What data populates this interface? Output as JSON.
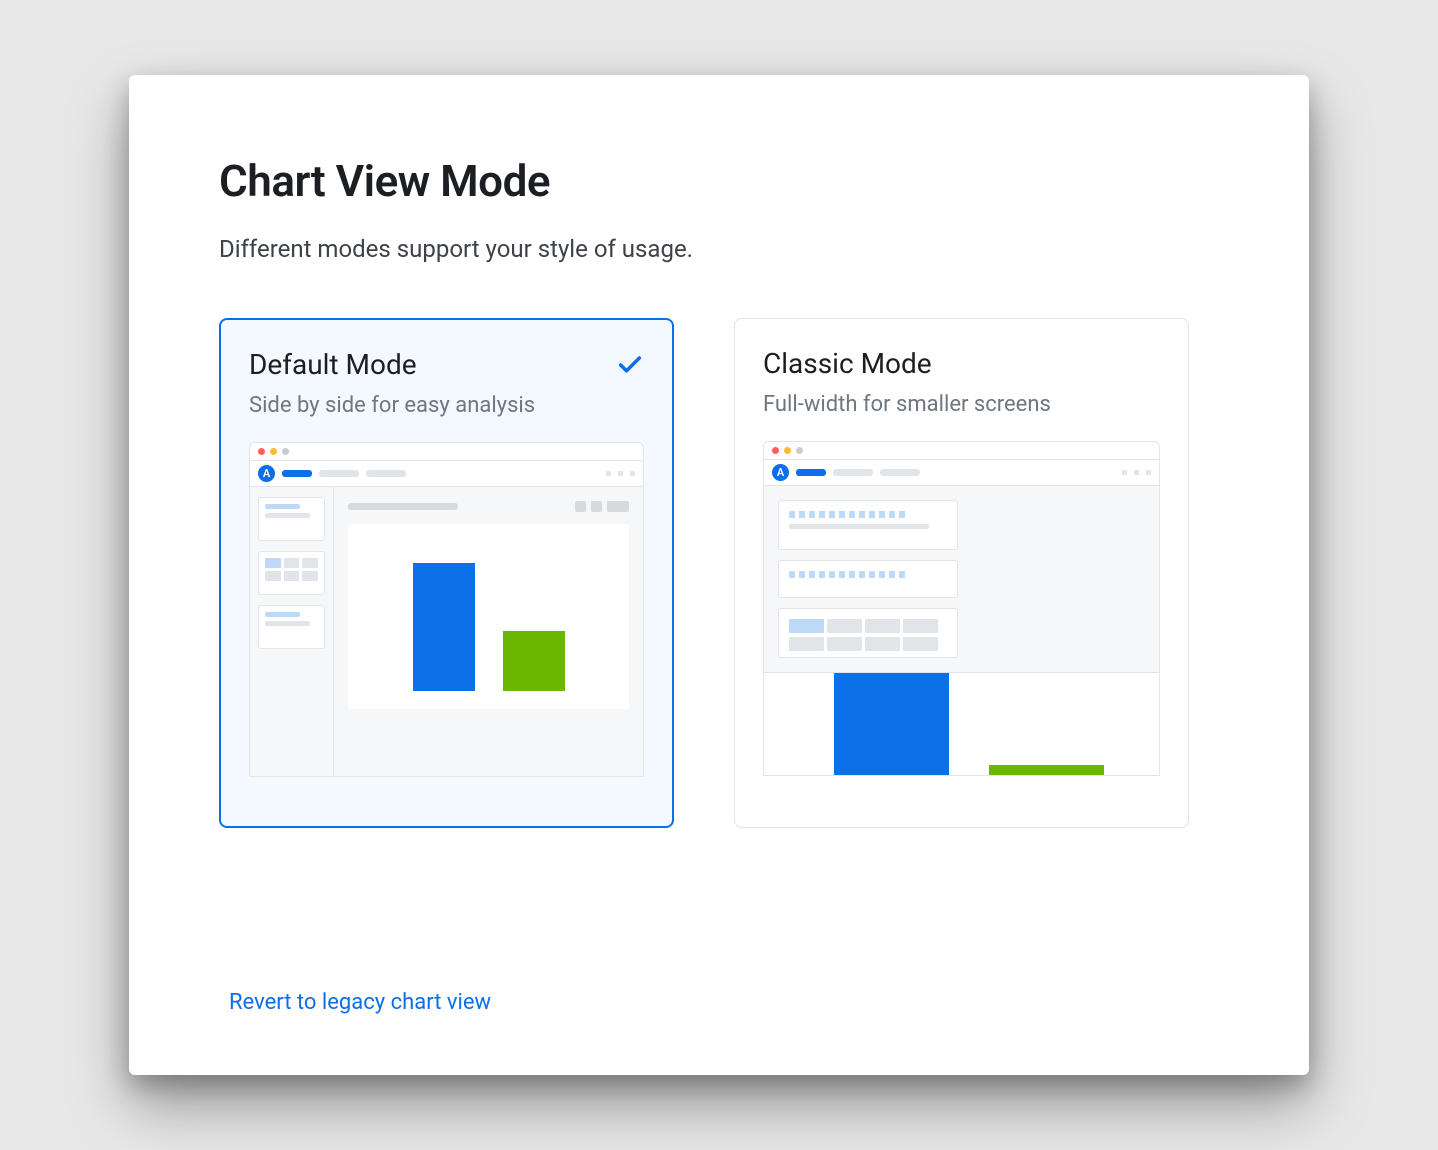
{
  "header": {
    "title": "Chart View Mode",
    "subtitle": "Different modes support your style of usage."
  },
  "cards": [
    {
      "title": "Default Mode",
      "description": "Side by side for easy analysis",
      "selected": true
    },
    {
      "title": "Classic Mode",
      "description": "Full-width for smaller screens",
      "selected": false
    }
  ],
  "footer": {
    "revert_label": "Revert to legacy chart view"
  },
  "colors": {
    "accent": "#0b6fe8",
    "green": "#6bb700"
  }
}
